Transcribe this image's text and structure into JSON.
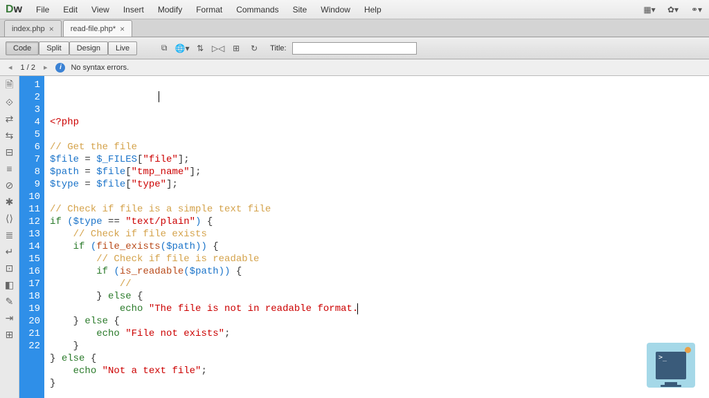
{
  "app": {
    "logo_d": "D",
    "logo_w": "w"
  },
  "menus": [
    "File",
    "Edit",
    "View",
    "Insert",
    "Modify",
    "Format",
    "Commands",
    "Site",
    "Window",
    "Help"
  ],
  "tabs": [
    {
      "label": "index.php",
      "modified": false,
      "active": false
    },
    {
      "label": "read-file.php*",
      "modified": true,
      "active": true
    }
  ],
  "toolbar": {
    "views": [
      "Code",
      "Split",
      "Design",
      "Live"
    ],
    "active_view": "Code",
    "title_label": "Title:",
    "title_value": ""
  },
  "status": {
    "page_indicator": "1 / 2",
    "message": "No syntax errors."
  },
  "code": {
    "lines": [
      [
        {
          "cls": "k-tag",
          "t": "<?php"
        }
      ],
      [
        {
          "cls": "",
          "t": ""
        }
      ],
      [
        {
          "cls": "k-comment",
          "t": "// Get the file"
        }
      ],
      [
        {
          "cls": "k-var",
          "t": "$file"
        },
        {
          "cls": "",
          "t": " = "
        },
        {
          "cls": "k-var",
          "t": "$_FILES"
        },
        {
          "cls": "",
          "t": "["
        },
        {
          "cls": "k-string",
          "t": "\"file\""
        },
        {
          "cls": "",
          "t": "];"
        }
      ],
      [
        {
          "cls": "k-var",
          "t": "$path"
        },
        {
          "cls": "",
          "t": " = "
        },
        {
          "cls": "k-var",
          "t": "$file"
        },
        {
          "cls": "",
          "t": "["
        },
        {
          "cls": "k-string",
          "t": "\"tmp_name\""
        },
        {
          "cls": "",
          "t": "];"
        }
      ],
      [
        {
          "cls": "k-var",
          "t": "$type"
        },
        {
          "cls": "",
          "t": " = "
        },
        {
          "cls": "k-var",
          "t": "$file"
        },
        {
          "cls": "",
          "t": "["
        },
        {
          "cls": "k-string",
          "t": "\"type\""
        },
        {
          "cls": "",
          "t": "];"
        }
      ],
      [
        {
          "cls": "",
          "t": ""
        }
      ],
      [
        {
          "cls": "k-comment",
          "t": "// Check if file is a simple text file"
        }
      ],
      [
        {
          "cls": "k-kw",
          "t": "if"
        },
        {
          "cls": "",
          "t": " "
        },
        {
          "cls": "k-paren",
          "t": "("
        },
        {
          "cls": "k-var",
          "t": "$type"
        },
        {
          "cls": "",
          "t": " == "
        },
        {
          "cls": "k-string",
          "t": "\"text/plain\""
        },
        {
          "cls": "k-paren",
          "t": ")"
        },
        {
          "cls": "",
          "t": " {"
        }
      ],
      [
        {
          "cls": "",
          "t": "    "
        },
        {
          "cls": "k-comment",
          "t": "// Check if file exists"
        }
      ],
      [
        {
          "cls": "",
          "t": "    "
        },
        {
          "cls": "k-kw",
          "t": "if"
        },
        {
          "cls": "",
          "t": " "
        },
        {
          "cls": "k-paren",
          "t": "("
        },
        {
          "cls": "k-func",
          "t": "file_exists"
        },
        {
          "cls": "k-paren",
          "t": "("
        },
        {
          "cls": "k-var",
          "t": "$path"
        },
        {
          "cls": "k-paren",
          "t": "))"
        },
        {
          "cls": "",
          "t": " {"
        }
      ],
      [
        {
          "cls": "",
          "t": "        "
        },
        {
          "cls": "k-comment",
          "t": "// Check if file is readable"
        }
      ],
      [
        {
          "cls": "",
          "t": "        "
        },
        {
          "cls": "k-kw",
          "t": "if"
        },
        {
          "cls": "",
          "t": " "
        },
        {
          "cls": "k-paren",
          "t": "("
        },
        {
          "cls": "k-func",
          "t": "is_readable"
        },
        {
          "cls": "k-paren",
          "t": "("
        },
        {
          "cls": "k-var",
          "t": "$path"
        },
        {
          "cls": "k-paren",
          "t": "))"
        },
        {
          "cls": "",
          "t": " {"
        }
      ],
      [
        {
          "cls": "",
          "t": "            "
        },
        {
          "cls": "k-comment",
          "t": "//"
        }
      ],
      [
        {
          "cls": "",
          "t": "        } "
        },
        {
          "cls": "k-kw",
          "t": "else"
        },
        {
          "cls": "",
          "t": " {"
        }
      ],
      [
        {
          "cls": "",
          "t": "            "
        },
        {
          "cls": "k-kw",
          "t": "echo"
        },
        {
          "cls": "",
          "t": " "
        },
        {
          "cls": "k-string",
          "t": "\"The file is not in readable format."
        }
      ],
      [
        {
          "cls": "",
          "t": "    } "
        },
        {
          "cls": "k-kw",
          "t": "else"
        },
        {
          "cls": "",
          "t": " {"
        }
      ],
      [
        {
          "cls": "",
          "t": "        "
        },
        {
          "cls": "k-kw",
          "t": "echo"
        },
        {
          "cls": "",
          "t": " "
        },
        {
          "cls": "k-string",
          "t": "\"File not exists\""
        },
        {
          "cls": "",
          "t": ";"
        }
      ],
      [
        {
          "cls": "",
          "t": "    }"
        }
      ],
      [
        {
          "cls": "",
          "t": "} "
        },
        {
          "cls": "k-kw",
          "t": "else"
        },
        {
          "cls": "",
          "t": " {"
        }
      ],
      [
        {
          "cls": "",
          "t": "    "
        },
        {
          "cls": "k-kw",
          "t": "echo"
        },
        {
          "cls": "",
          "t": " "
        },
        {
          "cls": "k-string",
          "t": "\"Not a text file\""
        },
        {
          "cls": "",
          "t": ";"
        }
      ],
      [
        {
          "cls": "",
          "t": "}"
        }
      ]
    ]
  }
}
